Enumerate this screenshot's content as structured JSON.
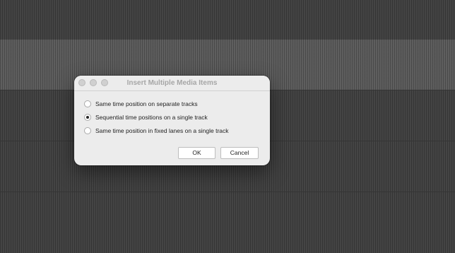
{
  "dialog": {
    "title": "Insert Multiple Media Items",
    "options": [
      {
        "label": "Same time position on separate tracks",
        "selected": false
      },
      {
        "label": "Sequential time positions on a single track",
        "selected": true
      },
      {
        "label": "Same time position in fixed lanes on a single track",
        "selected": false
      }
    ],
    "buttons": {
      "ok": "OK",
      "cancel": "Cancel"
    }
  }
}
